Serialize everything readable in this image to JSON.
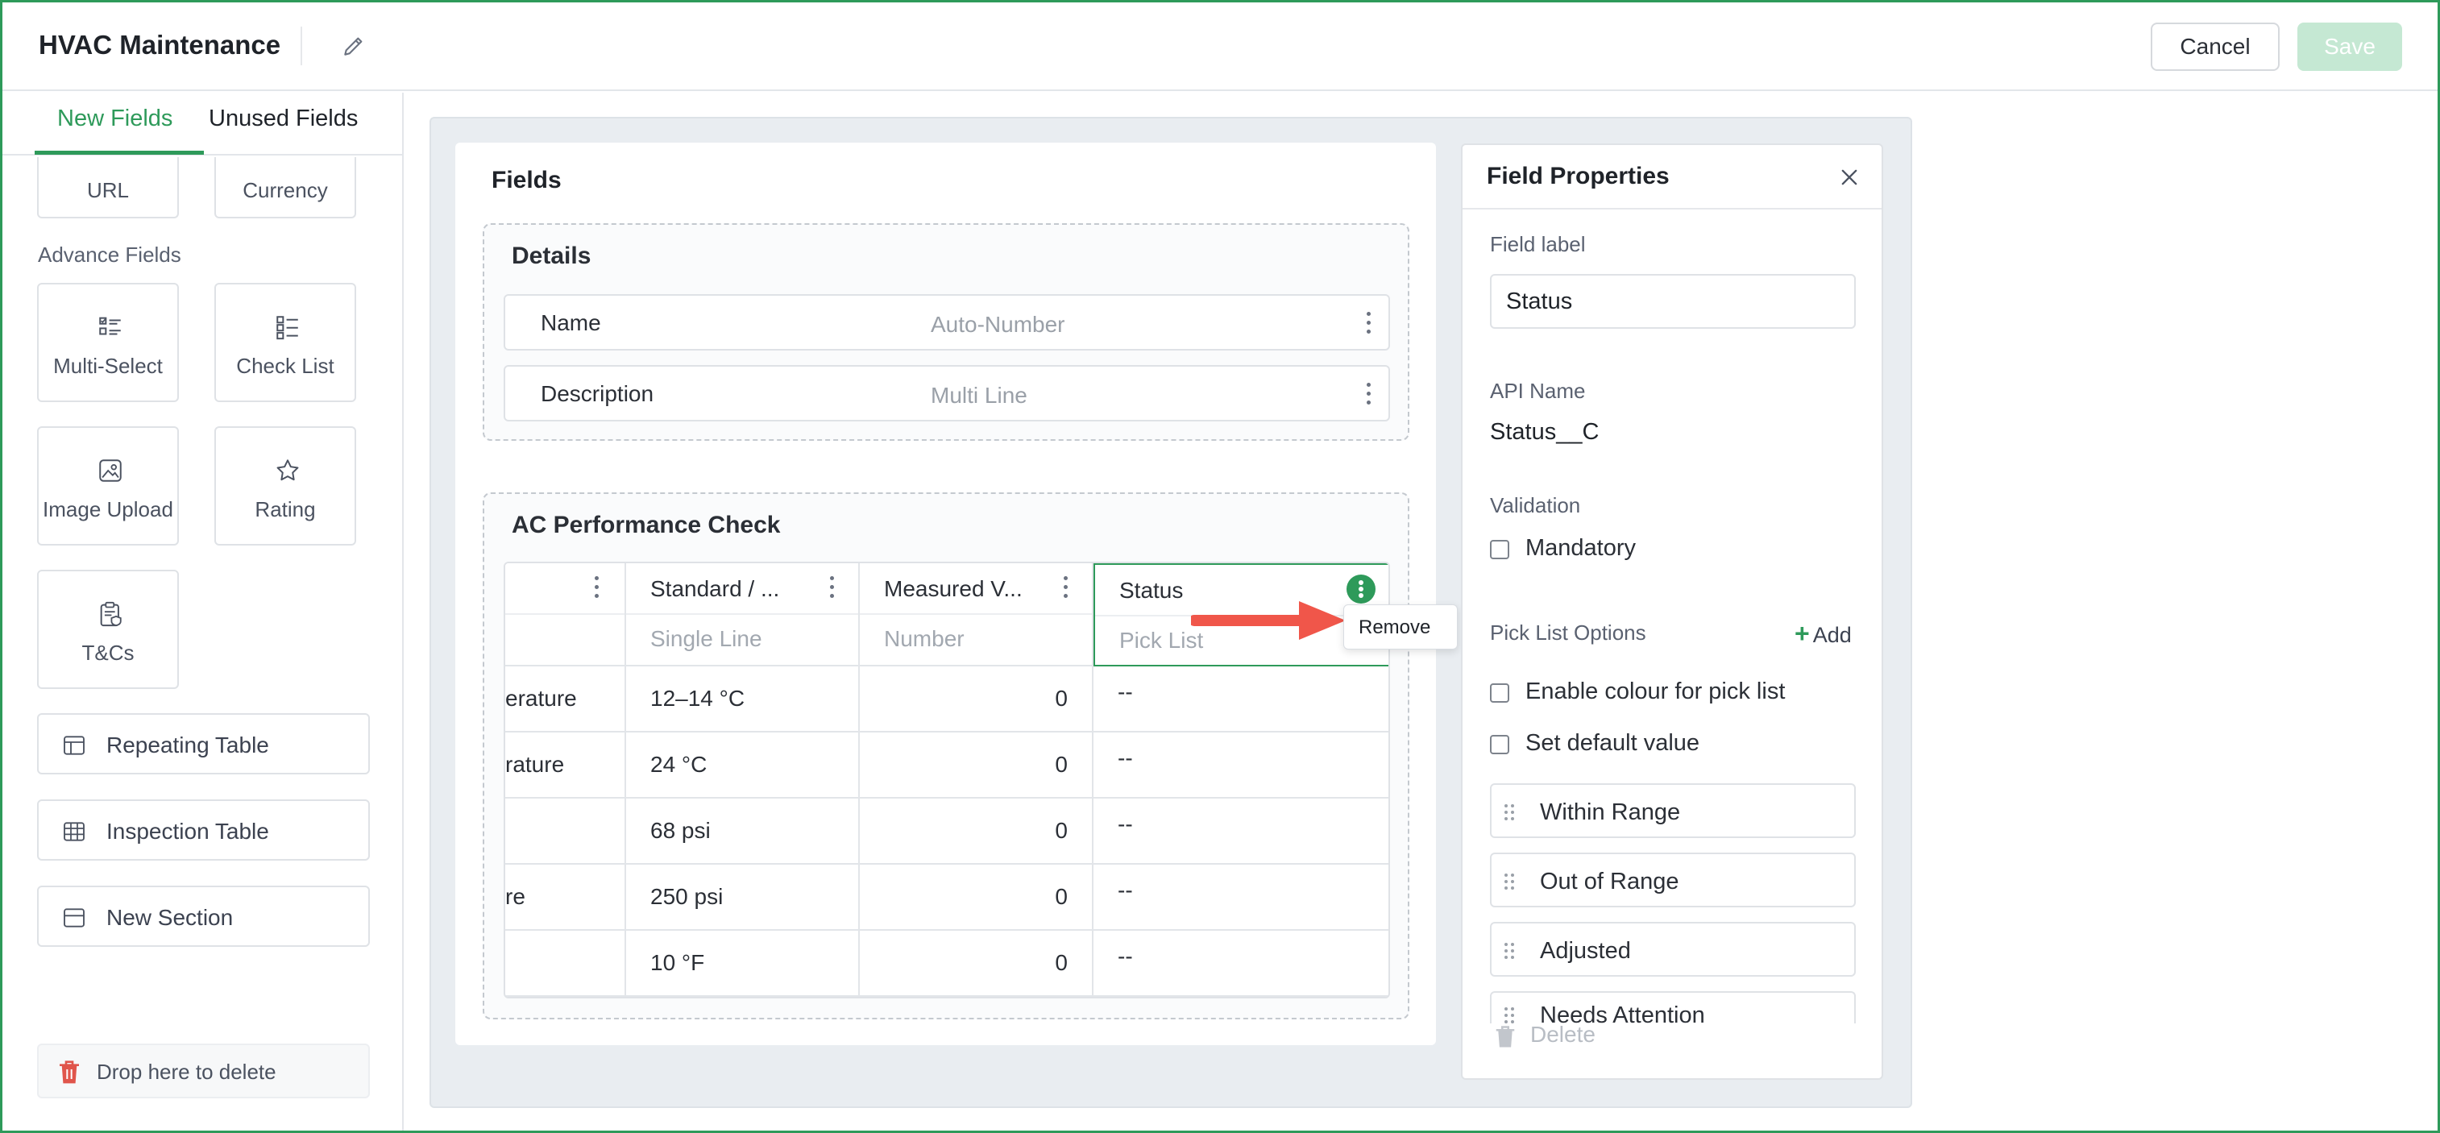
{
  "header": {
    "title": "HVAC Maintenance",
    "cancel_label": "Cancel",
    "save_label": "Save"
  },
  "left_panel": {
    "tabs": [
      "New Fields",
      "Unused Fields"
    ],
    "active_tab": "New Fields",
    "basic_tiles": [
      "URL",
      "Currency"
    ],
    "advance_section_label": "Advance Fields",
    "advance_tiles": [
      "Multi-Select",
      "Check List",
      "Image Upload",
      "Rating",
      "T&Cs"
    ],
    "wide_buttons": [
      "Repeating Table",
      "Inspection Table",
      "New Section"
    ],
    "drop_delete_label": "Drop here to delete"
  },
  "canvas": {
    "fields_title": "Fields",
    "details_section": {
      "title": "Details",
      "fields": [
        {
          "name": "Name",
          "type": "Auto-Number"
        },
        {
          "name": "Description",
          "type": "Multi Line"
        }
      ]
    },
    "ac_section": {
      "title": "AC Performance Check",
      "columns": [
        {
          "name": "",
          "type": ""
        },
        {
          "name": "Standard / ...",
          "type": "Single Line"
        },
        {
          "name": "Measured V...",
          "type": "Number"
        },
        {
          "name": "Status",
          "type": "Pick List"
        }
      ],
      "rows": [
        [
          "erature",
          "12–14 °C",
          "0",
          "--"
        ],
        [
          "rature",
          "24 °C",
          "0",
          "--"
        ],
        [
          "",
          "68 psi",
          "0",
          "--"
        ],
        [
          "re",
          "250 psi",
          "0",
          "--"
        ],
        [
          "",
          "10 °F",
          "0",
          "--"
        ]
      ]
    },
    "tooltip_label": "Remove"
  },
  "properties": {
    "title": "Field Properties",
    "field_label_caption": "Field label",
    "field_label_value": "Status",
    "api_name_caption": "API Name",
    "api_name_value": "Status__C",
    "validation_caption": "Validation",
    "mandatory_label": "Mandatory",
    "picklist_caption": "Pick List Options",
    "add_label": "Add",
    "enable_colour_label": "Enable colour for pick list",
    "default_value_label": "Set default value",
    "options": [
      "Within Range",
      "Out of Range",
      "Adjusted",
      "Needs Attention"
    ],
    "delete_label": "Delete"
  },
  "colors": {
    "accent": "#2e9a5a",
    "arrow": "#f0564a",
    "save_disabled": "#c5e8d3"
  }
}
